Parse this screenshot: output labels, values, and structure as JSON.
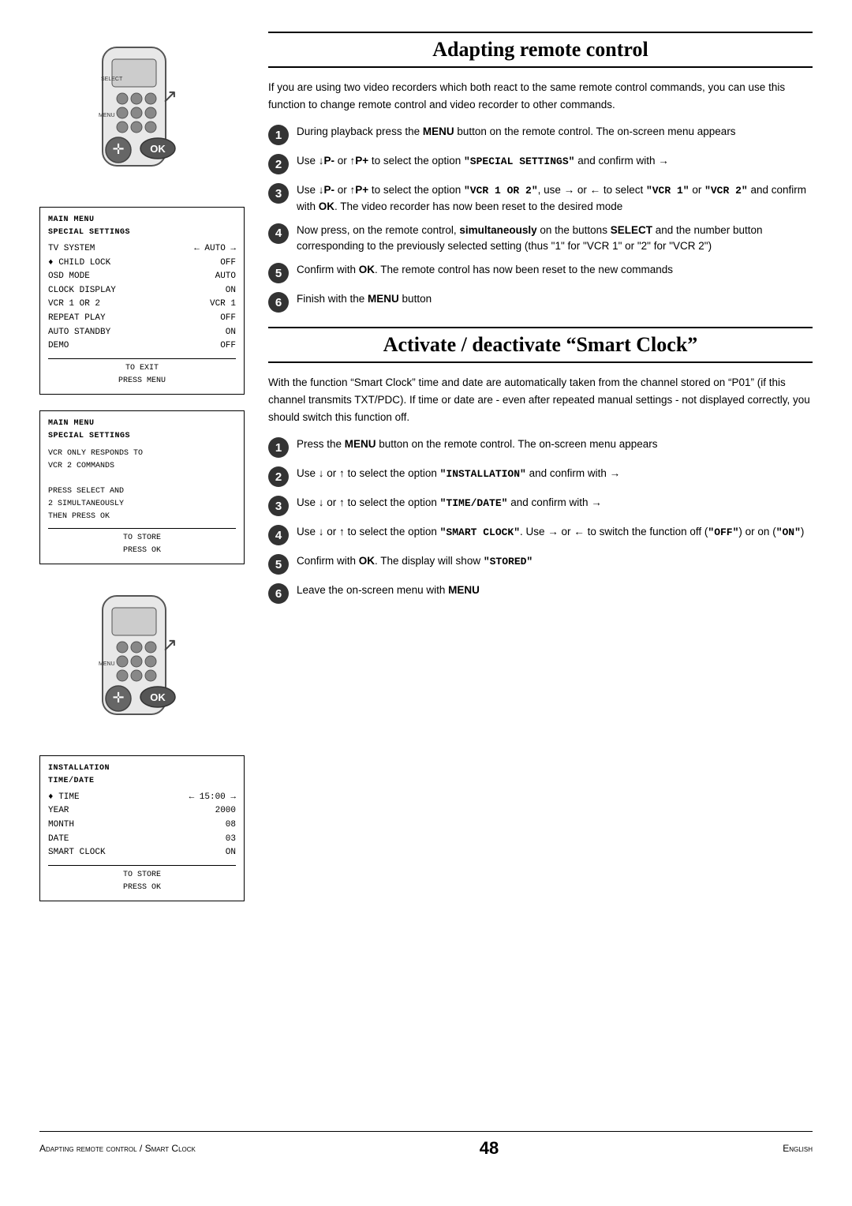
{
  "page": {
    "pageNumber": "48",
    "footerLeft": "Adapting remote control / Smart Clock",
    "footerRight": "English"
  },
  "adaptingSection": {
    "heading": "Adapting remote control",
    "intro": "If you are using two video recorders which both react to the same remote control commands, you can use this function to change remote control and video recorder to other commands.",
    "steps": [
      {
        "num": "1",
        "text": "During playback press the MENU button on the remote control. The on-screen menu appears"
      },
      {
        "num": "2",
        "text": "Use ↓P- or ↑P+ to select the option \"SPECIAL SETTINGS\" and confirm with →"
      },
      {
        "num": "3",
        "text": "Use ↓P- or ↑P+ to select the option \"VCR 1 OR 2\", use → or ← to select \"VCR 1\" or \"VCR 2\" and confirm with OK. The video recorder has now been reset to the desired mode"
      },
      {
        "num": "4",
        "text": "Now press, on the remote control, simultaneously on the buttons SELECT and the number button corresponding to the previously selected setting (thus \"1\" for \"VCR 1\" or \"2\" for \"VCR 2\")"
      },
      {
        "num": "5",
        "text": "Confirm with OK. The remote control has now been reset to the new commands"
      },
      {
        "num": "6",
        "text": "Finish with the MENU button"
      }
    ]
  },
  "smartClockSection": {
    "heading": "Activate / deactivate “Smart Clock”",
    "intro": "With the function “Smart Clock” time and date are automatically taken from the channel stored on “P01” (if this channel transmits TXT/PDC). If time or date are - even after repeated manual settings - not displayed correctly, you should switch this function off.",
    "steps": [
      {
        "num": "1",
        "text": "Press the MENU button on the remote control. The on-screen menu appears"
      },
      {
        "num": "2",
        "text": "Use ↓ or ↑ to select the option \"INSTALLATION\" and confirm with →"
      },
      {
        "num": "3",
        "text": "Use ↓ or ↑ to select the option \"TIME/DATE\" and confirm with →"
      },
      {
        "num": "4",
        "text": "Use ↓ or ↑ to select the option \"SMART CLOCK\". Use → or ← to switch the function off (\"OFF\") or on (\"ON\")"
      },
      {
        "num": "5",
        "text": "Confirm with OK. The display will show \"STORED\""
      },
      {
        "num": "6",
        "text": "Leave the on-screen menu with MENU"
      }
    ]
  },
  "screen1": {
    "title1": "MAIN MENU",
    "title2": "SPECIAL SETTINGS",
    "rows": [
      {
        "label": "TV SYSTEM",
        "value": "← AUTO →"
      },
      {
        "label": "• CHILD LOCK",
        "value": "OFF"
      },
      {
        "label": "OSD MODE",
        "value": "AUTO"
      },
      {
        "label": "CLOCK DISPLAY",
        "value": "ON"
      },
      {
        "label": "VCR 1 OR 2",
        "value": "VCR 1"
      },
      {
        "label": "REPEAT PLAY",
        "value": "OFF"
      },
      {
        "label": "AUTO STANDBY",
        "value": "ON"
      },
      {
        "label": "DEMO",
        "value": "OFF"
      }
    ],
    "footer1": "TO EXIT",
    "footer2": "PRESS MENU"
  },
  "screen2": {
    "title1": "MAIN MENU",
    "title2": "SPECIAL SETTINGS",
    "lines": [
      "VCR ONLY RESPONDS TO",
      "VCR 2 COMMANDS",
      "",
      "PRESS SELECT AND",
      "2 SIMULTANEOUSLY",
      "THEN PRESS OK"
    ],
    "footer1": "TO STORE",
    "footer2": "PRESS OK"
  },
  "screen3": {
    "title1": "INSTALLATION",
    "title2": "TIME/DATE",
    "rows": [
      {
        "label": "• TIME",
        "value": "← 15:00 →"
      },
      {
        "label": "  YEAR",
        "value": "2000"
      },
      {
        "label": "  MONTH",
        "value": "08"
      },
      {
        "label": "  DATE",
        "value": "03"
      },
      {
        "label": "  SMART CLOCK",
        "value": "ON"
      }
    ],
    "footer1": "TO STORE",
    "footer2": "PRESS OK"
  }
}
